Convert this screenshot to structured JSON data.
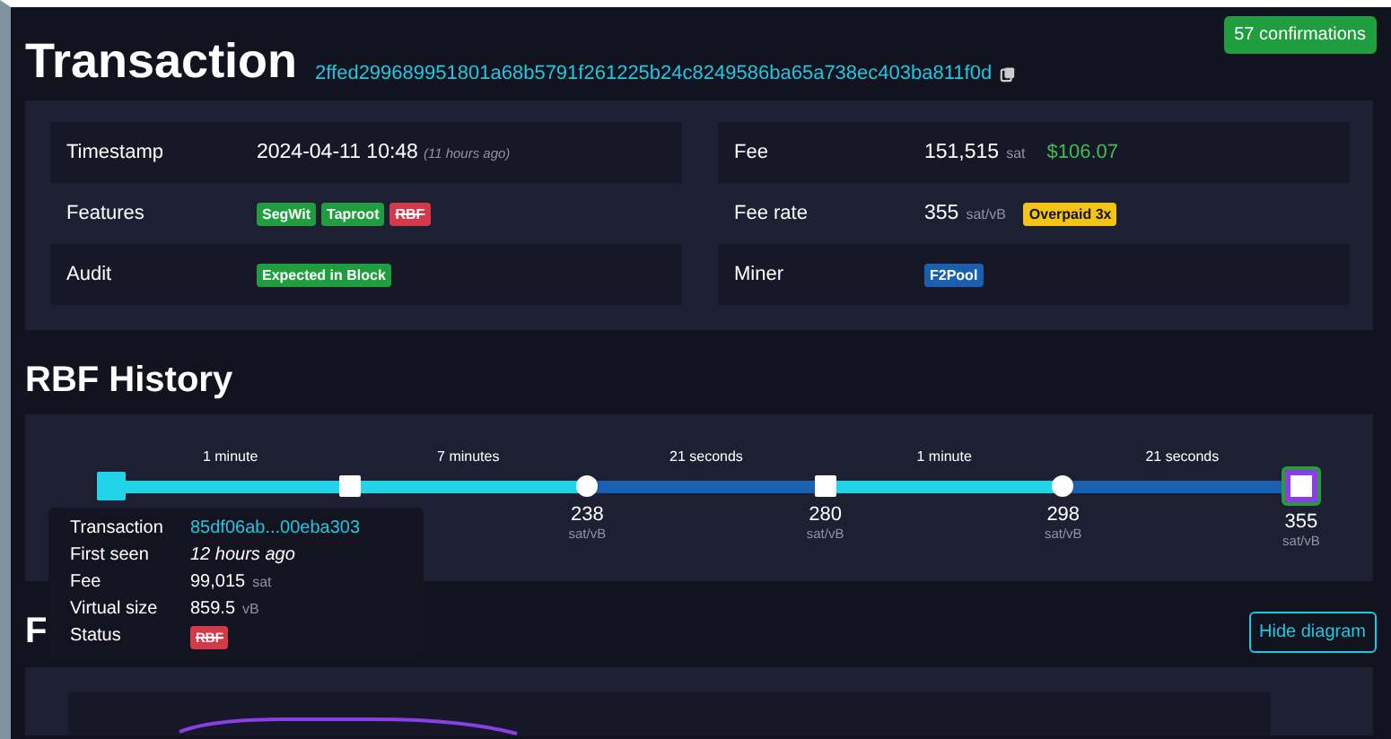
{
  "title": "Transaction",
  "txid": "2ffed299689951801a68b5791f261225b24c8249586ba65a738ec403ba811f0d",
  "confirmations": "57 confirmations",
  "details": {
    "left": [
      {
        "label": "Timestamp",
        "value": "2024-04-11 10:48",
        "note": "(11 hours ago)"
      },
      {
        "label": "Features",
        "badges": [
          {
            "text": "SegWit",
            "color": "#1f9d3f",
            "struck": false
          },
          {
            "text": "Taproot",
            "color": "#1f9d3f",
            "struck": false
          },
          {
            "text": "RBF",
            "color": "#d23a4c",
            "struck": true
          }
        ]
      },
      {
        "label": "Audit",
        "badges": [
          {
            "text": "Expected in Block",
            "color": "#1f9d3f",
            "struck": false
          }
        ]
      }
    ],
    "right": [
      {
        "label": "Fee",
        "value": "151,515",
        "unit": "sat",
        "fiat": "$106.07"
      },
      {
        "label": "Fee rate",
        "value": "355",
        "unit": "sat/vB",
        "badges": [
          {
            "text": "Overpaid 3x",
            "color": "#f3c316",
            "struck": false
          }
        ]
      },
      {
        "label": "Miner",
        "badges": [
          {
            "text": "F2Pool",
            "color": "#1b5fb0",
            "struck": false
          }
        ]
      }
    ]
  },
  "rbf": {
    "heading": "RBF History",
    "nodes": [
      {
        "kind": "square",
        "selected": true,
        "final": false
      },
      {
        "kind": "square",
        "selected": false,
        "final": false
      },
      {
        "kind": "circle",
        "selected": false,
        "final": false,
        "rate": "238",
        "unit": "sat/vB"
      },
      {
        "kind": "square",
        "selected": false,
        "final": false,
        "rate": "280",
        "unit": "sat/vB"
      },
      {
        "kind": "circle",
        "selected": false,
        "final": false,
        "rate": "298",
        "unit": "sat/vB"
      },
      {
        "kind": "square",
        "selected": false,
        "final": true,
        "rate": "355",
        "unit": "sat/vB"
      }
    ],
    "intervals": [
      {
        "label": "1 minute",
        "highlighted": true
      },
      {
        "label": "7 minutes",
        "highlighted": true
      },
      {
        "label": "21 seconds",
        "highlighted": false
      },
      {
        "label": "1 minute",
        "highlighted": true
      },
      {
        "label": "21 seconds",
        "highlighted": false
      }
    ],
    "tooltip": [
      {
        "label": "Transaction",
        "link": "85df06ab...00eba303"
      },
      {
        "label": "First seen",
        "value": "12 hours ago",
        "italic": true
      },
      {
        "label": "Fee",
        "value": "99,015",
        "unit": "sat"
      },
      {
        "label": "Virtual size",
        "value": "859.5",
        "unit": "vB"
      },
      {
        "label": "Status",
        "badges": [
          {
            "text": "RBF",
            "color": "#d23a4c",
            "struck": true
          }
        ]
      }
    ]
  },
  "flow": {
    "heading": "F",
    "button": "Hide diagram"
  }
}
